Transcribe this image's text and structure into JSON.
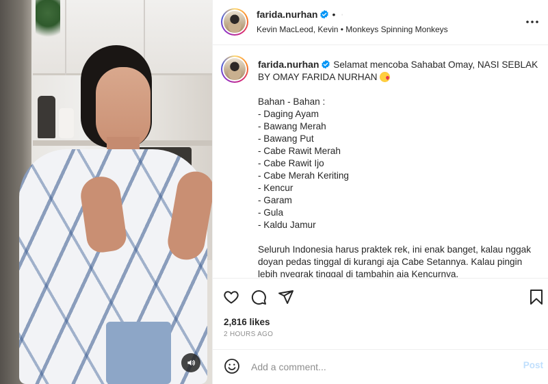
{
  "post": {
    "username": "farida.nurhan",
    "header_separator": "•",
    "follow_label": "·",
    "audio": "Kevin MacLeod, Kevin • Monkeys Spinning Monkeys"
  },
  "caption": {
    "text_line1": "Selamat mencoba Sahabat Omay, NASI SEBLAK BY OMAY FARIDA NURHAN",
    "ingredients_title": "Bahan - Bahan :",
    "ingredients": [
      "- Daging Ayam",
      "- Bawang Merah",
      "- Bawang Put",
      "- Cabe Rawit Merah",
      "- Cabe Rawit Ijo",
      "- Cabe Merah Keriting",
      "- Kencur",
      "- Garam",
      "- Gula",
      "- Kaldu Jamur"
    ],
    "closing": "Seluruh Indonesia harus praktek rek, ini enak banget, kalau nggak doyan pedas tinggal di kurangi aja Cabe Setannya. Kalau pingin lebih nyegrak tinggal di tambahin aja Kencurnya."
  },
  "stats": {
    "likes": "2,816 likes",
    "time": "2 HOURS AGO"
  },
  "comment": {
    "placeholder": "Add a comment...",
    "post_label": "Post"
  },
  "colors": {
    "verified": "#0095f6",
    "post_disabled": "#c0dffd",
    "muted": "#8e8e8e"
  },
  "icons": {
    "like": "heart-icon",
    "comment": "comment-icon",
    "share": "paper-plane-icon",
    "save": "bookmark-icon",
    "more": "more-horizontal-icon",
    "audio": "speaker-icon",
    "emoji": "smiley-icon"
  }
}
